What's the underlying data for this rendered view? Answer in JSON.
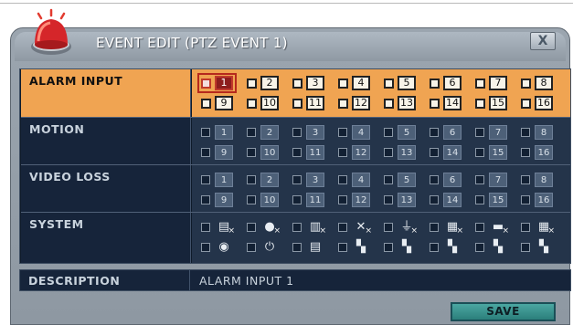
{
  "dialog": {
    "title": "EVENT EDIT (PTZ EVENT 1)",
    "close_label": "X",
    "save_label": "SAVE"
  },
  "sections": {
    "alarm_input": {
      "label": "ALARM INPUT",
      "channels": [
        "1",
        "2",
        "3",
        "4",
        "5",
        "6",
        "7",
        "8",
        "9",
        "10",
        "11",
        "12",
        "13",
        "14",
        "15",
        "16"
      ],
      "selected": "1"
    },
    "motion": {
      "label": "MOTION",
      "channels": [
        "1",
        "2",
        "3",
        "4",
        "5",
        "6",
        "7",
        "8",
        "9",
        "10",
        "11",
        "12",
        "13",
        "14",
        "15",
        "16"
      ]
    },
    "video_loss": {
      "label": "VIDEO LOSS",
      "channels": [
        "1",
        "2",
        "3",
        "4",
        "5",
        "6",
        "7",
        "8",
        "9",
        "10",
        "11",
        "12",
        "13",
        "14",
        "15",
        "16"
      ]
    },
    "system": {
      "label": "SYSTEM",
      "icons": [
        "disk-full-icon",
        "disk-error-icon",
        "disk-bad-icon",
        "fan-error-icon",
        "power-fail-icon",
        "network-icon",
        "login-fail-icon",
        "panel-icon",
        "user-icon",
        "power-icon",
        "printer-icon",
        "dip-switch-icon",
        "dip-switch-icon",
        "dip-switch-icon",
        "dip-switch-icon",
        "dip-switch-icon"
      ],
      "glyphs": [
        "▤",
        "●",
        "▥",
        "✕",
        "⏚",
        "▦",
        "▬",
        "▦",
        "◉",
        "⏻",
        "▤",
        "▚",
        "▚",
        "▚",
        "▚",
        "▚"
      ]
    }
  },
  "description": {
    "label": "DESCRIPTION",
    "value": "ALARM INPUT 1"
  },
  "colors": {
    "highlight": "#f0a452",
    "panel": "#24344a",
    "label_bg": "#16243a",
    "save": "#2b7f7b"
  }
}
